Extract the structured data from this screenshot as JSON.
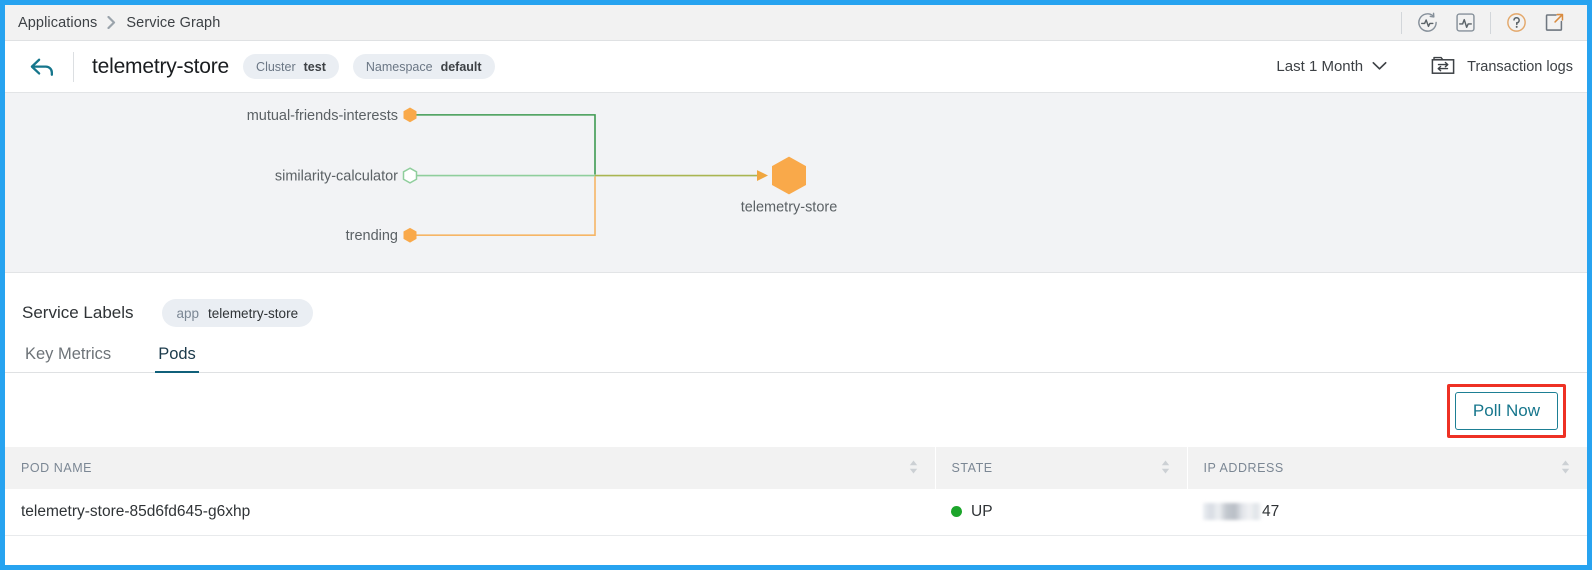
{
  "theme": {
    "frame_blue": "#27a3f0",
    "accent_teal": "#16768c",
    "highlight_red": "#ee3124",
    "status_green": "#1ca52b",
    "node_orange": "#f9a94a",
    "edge_green": "#4fa95f",
    "panel_gray": "#f2f3f5"
  },
  "breadcrumb": {
    "root": "Applications",
    "separator": "›",
    "current": "Service Graph",
    "icons": [
      {
        "name": "service-graph-icon",
        "glyph": "circular-pulse"
      },
      {
        "name": "metrics-icon",
        "glyph": "square-pulse"
      },
      {
        "name": "help-icon",
        "glyph": "question-circle"
      },
      {
        "name": "open-external-icon",
        "glyph": "external-link"
      }
    ]
  },
  "header": {
    "back_icon": "back-arrow-icon",
    "title": "telemetry-store",
    "badges": [
      {
        "key": "Cluster",
        "value": "test"
      },
      {
        "key": "Namespace",
        "value": "default"
      }
    ],
    "time_range": "Last 1 Month",
    "time_range_caret": "∨",
    "transaction_logs": "Transaction logs"
  },
  "graph": {
    "nodes": [
      {
        "id": "mutual-friends-interests",
        "label": "mutual-friends-interests",
        "type": "source",
        "shape": "hexagon",
        "fill": "#f9a94a",
        "hollow": false
      },
      {
        "id": "similarity-calculator",
        "label": "similarity-calculator",
        "type": "source",
        "shape": "hexagon",
        "fill": "#ffffff",
        "stroke": "#8fce9c",
        "hollow": true
      },
      {
        "id": "trending",
        "label": "trending",
        "type": "source",
        "shape": "hexagon",
        "fill": "#f9a94a",
        "hollow": false
      },
      {
        "id": "telemetry-store",
        "label": "telemetry-store",
        "type": "target",
        "shape": "hexagon",
        "fill": "#f9a94a",
        "hollow": false
      }
    ],
    "edges": [
      {
        "from": "mutual-friends-interests",
        "to": "telemetry-store",
        "color": "#3f9a52"
      },
      {
        "from": "similarity-calculator",
        "to": "telemetry-store",
        "color": "#8fce9c"
      },
      {
        "from": "trending",
        "to": "telemetry-store",
        "color": "#f6b565"
      }
    ]
  },
  "service_labels": {
    "title": "Service Labels",
    "labels": [
      {
        "key": "app",
        "value": "telemetry-store"
      }
    ]
  },
  "tabs": [
    {
      "id": "key-metrics",
      "label": "Key Metrics",
      "active": false
    },
    {
      "id": "pods",
      "label": "Pods",
      "active": true
    }
  ],
  "actions": {
    "poll_now": "Poll Now",
    "poll_now_highlighted": true
  },
  "table": {
    "columns": [
      {
        "id": "pod-name",
        "label": "POD NAME",
        "sortable": true
      },
      {
        "id": "state",
        "label": "STATE",
        "sortable": true
      },
      {
        "id": "ip-address",
        "label": "IP ADDRESS",
        "sortable": true
      }
    ],
    "rows": [
      {
        "pod_name": "telemetry-store-85d6fd645-g6xhp",
        "state": "UP",
        "state_color": "#1ca52b",
        "ip_redacted": true,
        "ip_visible_tail": "47"
      }
    ]
  }
}
